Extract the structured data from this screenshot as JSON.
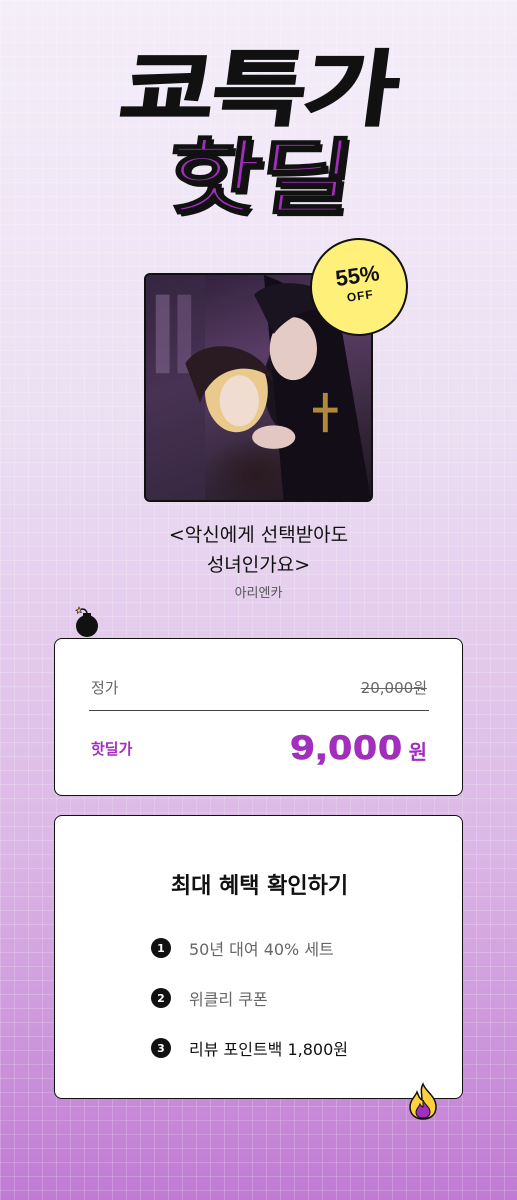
{
  "hero": {
    "line1": "쿄특가",
    "line2": "핫딜"
  },
  "badge": {
    "percent": "55%",
    "off": "OFF"
  },
  "book": {
    "title_line1": "<악신에게 선택받아도",
    "title_line2": "성녀인가요>",
    "author": "아리엔카"
  },
  "price": {
    "regular_label": "정가",
    "regular_value": "20,000원",
    "deal_label": "핫딜가",
    "deal_value": "9,000",
    "deal_unit": "원"
  },
  "benefits": {
    "title": "최대 혜택 확인하기",
    "items": [
      {
        "num": "1",
        "text": "50년 대여 40% 세트"
      },
      {
        "num": "2",
        "text": "위클리 쿠폰"
      },
      {
        "num": "3",
        "text": "리뷰 포인트백 1,800원"
      }
    ]
  },
  "colors": {
    "accent": "#a22ebd",
    "badge": "#fff07a"
  },
  "icons": [
    "bomb-icon",
    "fire-icon"
  ]
}
